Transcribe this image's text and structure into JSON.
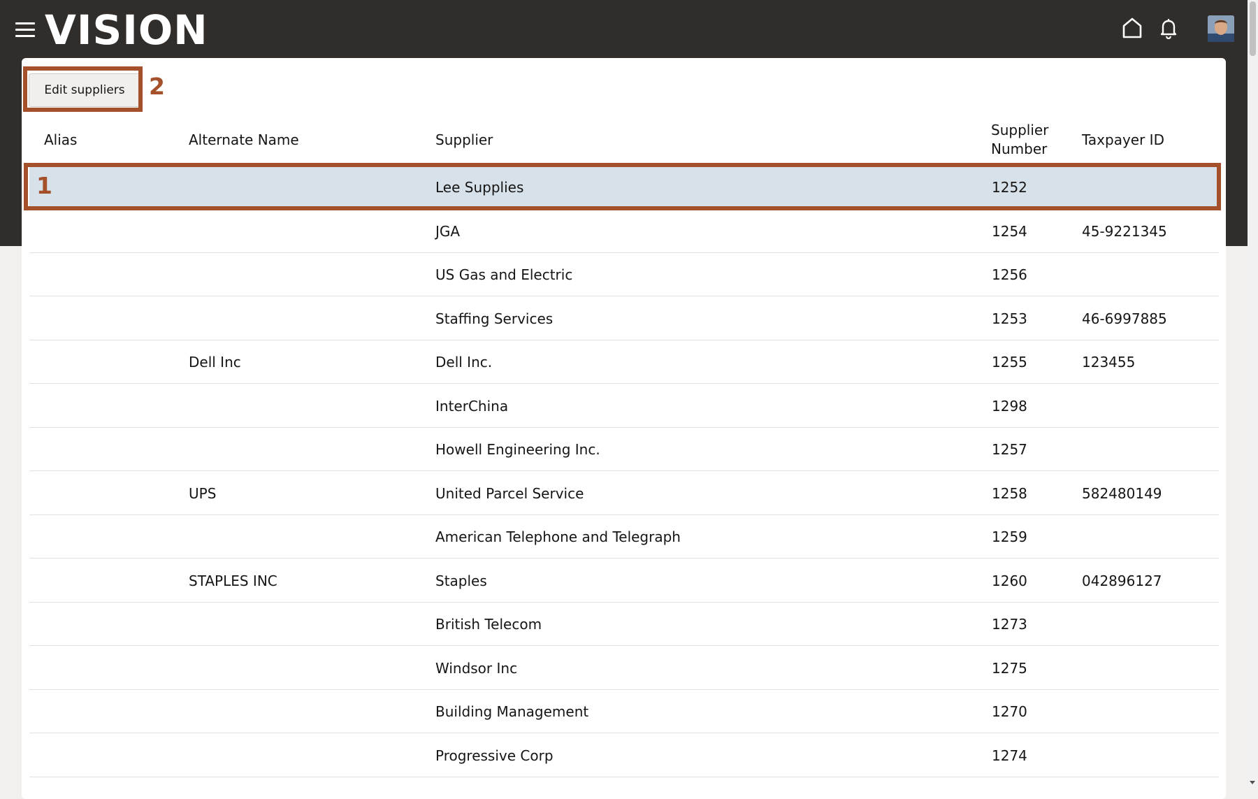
{
  "header": {
    "logo": "VISION",
    "icons": [
      "menu-icon",
      "home-icon",
      "bell-icon",
      "avatar"
    ]
  },
  "toolbar": {
    "edit_label": "Edit suppliers"
  },
  "callouts": {
    "row": "1",
    "button": "2",
    "color": "#a4502a"
  },
  "table": {
    "columns": {
      "alias": "Alias",
      "alternate_name": "Alternate Name",
      "supplier": "Supplier",
      "supplier_number": "Supplier Number",
      "taxpayer_id": "Taxpayer ID"
    },
    "rows": [
      {
        "alias": "",
        "alternate_name": "",
        "supplier": "Lee Supplies",
        "supplier_number": "1252",
        "taxpayer_id": "",
        "selected": true
      },
      {
        "alias": "",
        "alternate_name": "",
        "supplier": "JGA",
        "supplier_number": "1254",
        "taxpayer_id": "45-9221345"
      },
      {
        "alias": "",
        "alternate_name": "",
        "supplier": "US Gas and Electric",
        "supplier_number": "1256",
        "taxpayer_id": ""
      },
      {
        "alias": "",
        "alternate_name": "",
        "supplier": "Staffing Services",
        "supplier_number": "1253",
        "taxpayer_id": "46-6997885"
      },
      {
        "alias": "",
        "alternate_name": "Dell Inc",
        "supplier": "Dell Inc.",
        "supplier_number": "1255",
        "taxpayer_id": "123455"
      },
      {
        "alias": "",
        "alternate_name": "",
        "supplier": "InterChina",
        "supplier_number": "1298",
        "taxpayer_id": ""
      },
      {
        "alias": "",
        "alternate_name": "",
        "supplier": "Howell Engineering Inc.",
        "supplier_number": "1257",
        "taxpayer_id": ""
      },
      {
        "alias": "",
        "alternate_name": "UPS",
        "supplier": "United Parcel Service",
        "supplier_number": "1258",
        "taxpayer_id": "582480149"
      },
      {
        "alias": "",
        "alternate_name": "",
        "supplier": "American Telephone and Telegraph",
        "supplier_number": "1259",
        "taxpayer_id": ""
      },
      {
        "alias": "",
        "alternate_name": "STAPLES INC",
        "supplier": "Staples",
        "supplier_number": "1260",
        "taxpayer_id": "042896127"
      },
      {
        "alias": "",
        "alternate_name": "",
        "supplier": "British Telecom",
        "supplier_number": "1273",
        "taxpayer_id": ""
      },
      {
        "alias": "",
        "alternate_name": "",
        "supplier": "Windsor Inc",
        "supplier_number": "1275",
        "taxpayer_id": ""
      },
      {
        "alias": "",
        "alternate_name": "",
        "supplier": "Building Management",
        "supplier_number": "1270",
        "taxpayer_id": ""
      },
      {
        "alias": "",
        "alternate_name": "",
        "supplier": "Progressive Corp",
        "supplier_number": "1274",
        "taxpayer_id": ""
      }
    ]
  }
}
